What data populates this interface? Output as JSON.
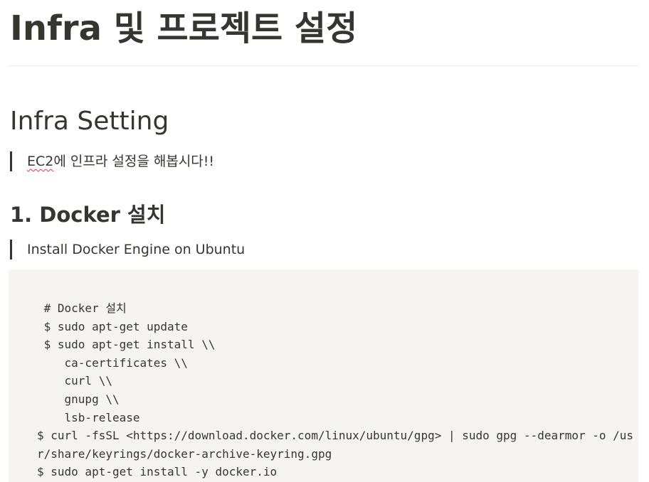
{
  "page": {
    "title": "Infra 및 프로젝트 설정"
  },
  "sections": {
    "infra_heading": "Infra Setting",
    "infra_quote": {
      "spellchecked_word": "EC2",
      "rest": "에 인프라 설정을 해봅시다!!"
    },
    "docker_heading": "1. Docker 설치",
    "docker_quote": "Install Docker Engine on Ubuntu"
  },
  "code_block": {
    "lines": [
      " # Docker 설치",
      " $ sudo apt-get update",
      " $ sudo apt-get install \\\\",
      "    ca-certificates \\\\",
      "    curl \\\\",
      "    gnupg \\\\",
      "    lsb-release",
      "$ curl -fsSL <https://download.docker.com/linux/ubuntu/gpg> | sudo gpg --dearmor -o /us",
      "r/share/keyrings/docker-archive-keyring.gpg",
      "$ sudo apt-get install -y docker.io"
    ]
  },
  "colors": {
    "text": "#37352f",
    "code_background": "#f5f4f1",
    "divider": "#e9e9e7",
    "spellcheck_underline": "#e03e3e"
  }
}
